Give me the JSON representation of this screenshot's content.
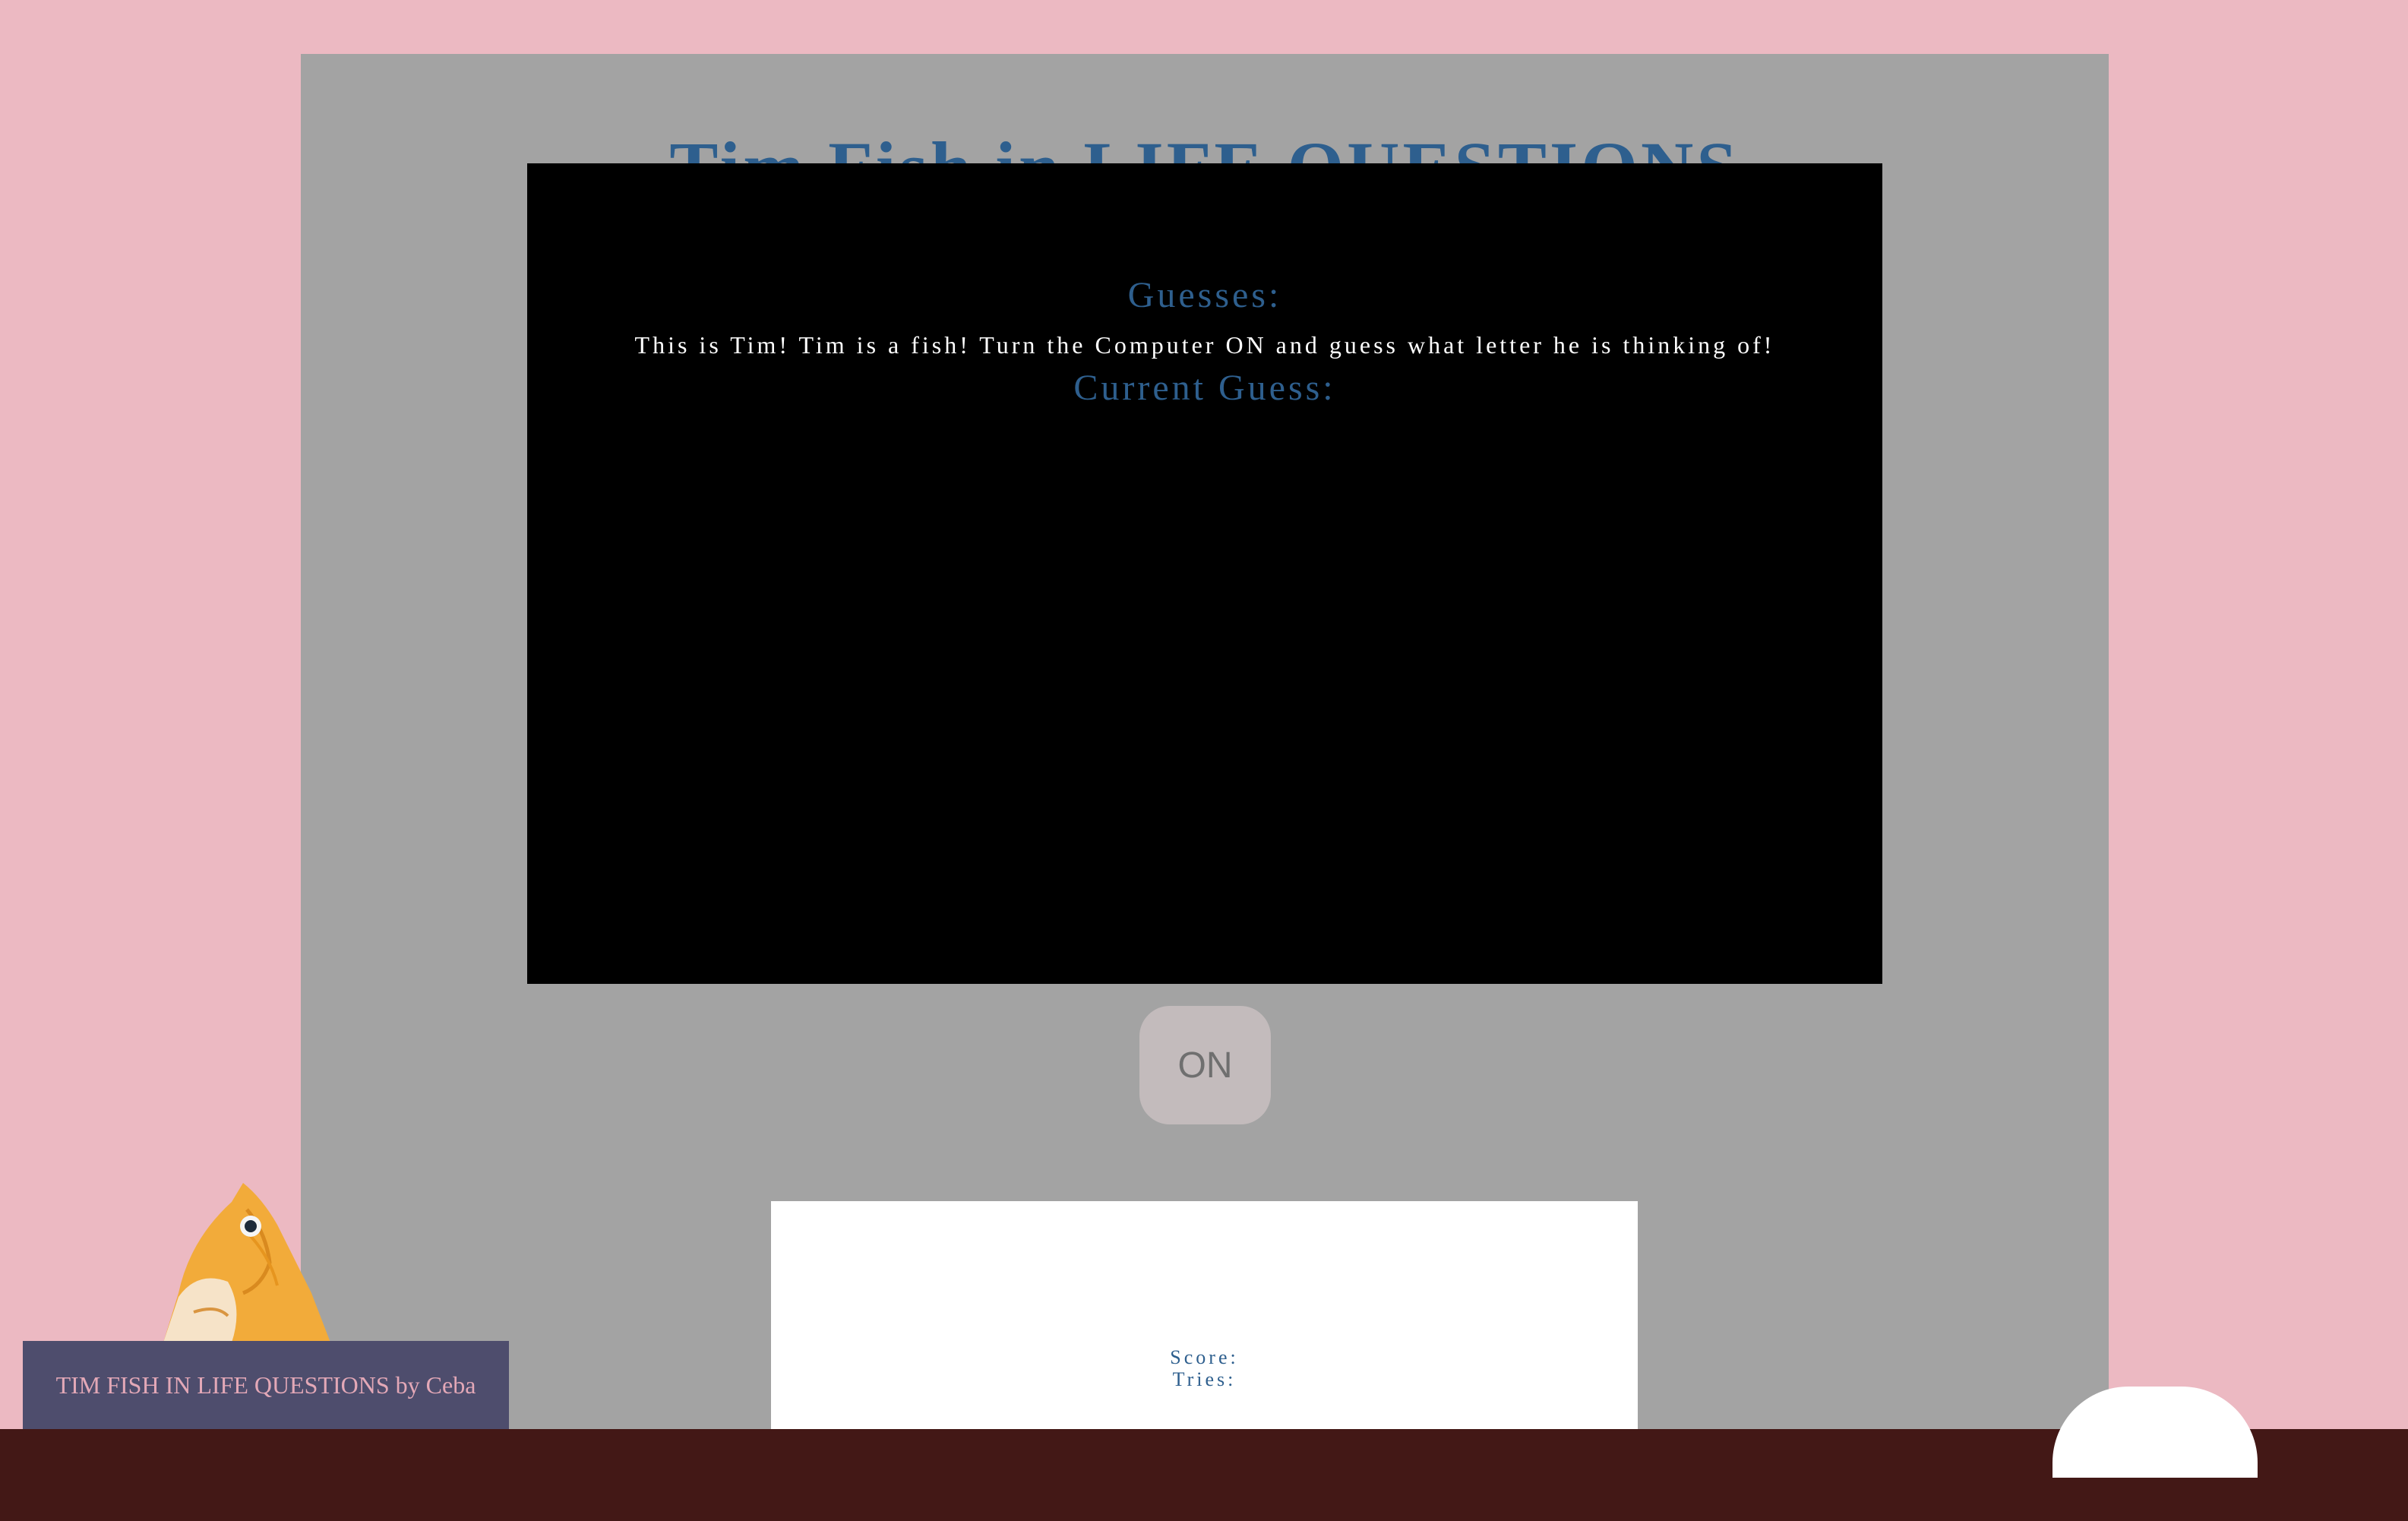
{
  "title": "Tim Fish in LIFE QUESTIONS",
  "screen": {
    "guesses_label": "Guesses:",
    "intro_text": "This is Tim! Tim is a fish! Turn the Computer ON and guess what letter he is thinking of!",
    "current_guess_label": "Current Guess:"
  },
  "power_button": {
    "label": "ON"
  },
  "scoreboard": {
    "score_label": "Score:",
    "tries_label": "Tries:"
  },
  "credit": "TIM FISH IN LIFE QUESTIONS by Ceba",
  "colors": {
    "background": "#ecb9c2",
    "monitor": "#a3a3a3",
    "screen": "#000000",
    "heading_blue": "#2e5f8e",
    "floor": "#431816",
    "credit_box": "#4e4d6d",
    "credit_text": "#e3a8b7",
    "button": "#c3bbbc"
  },
  "icons": {
    "character": "goldfish-icon",
    "mouse": "computer-mouse-icon"
  }
}
